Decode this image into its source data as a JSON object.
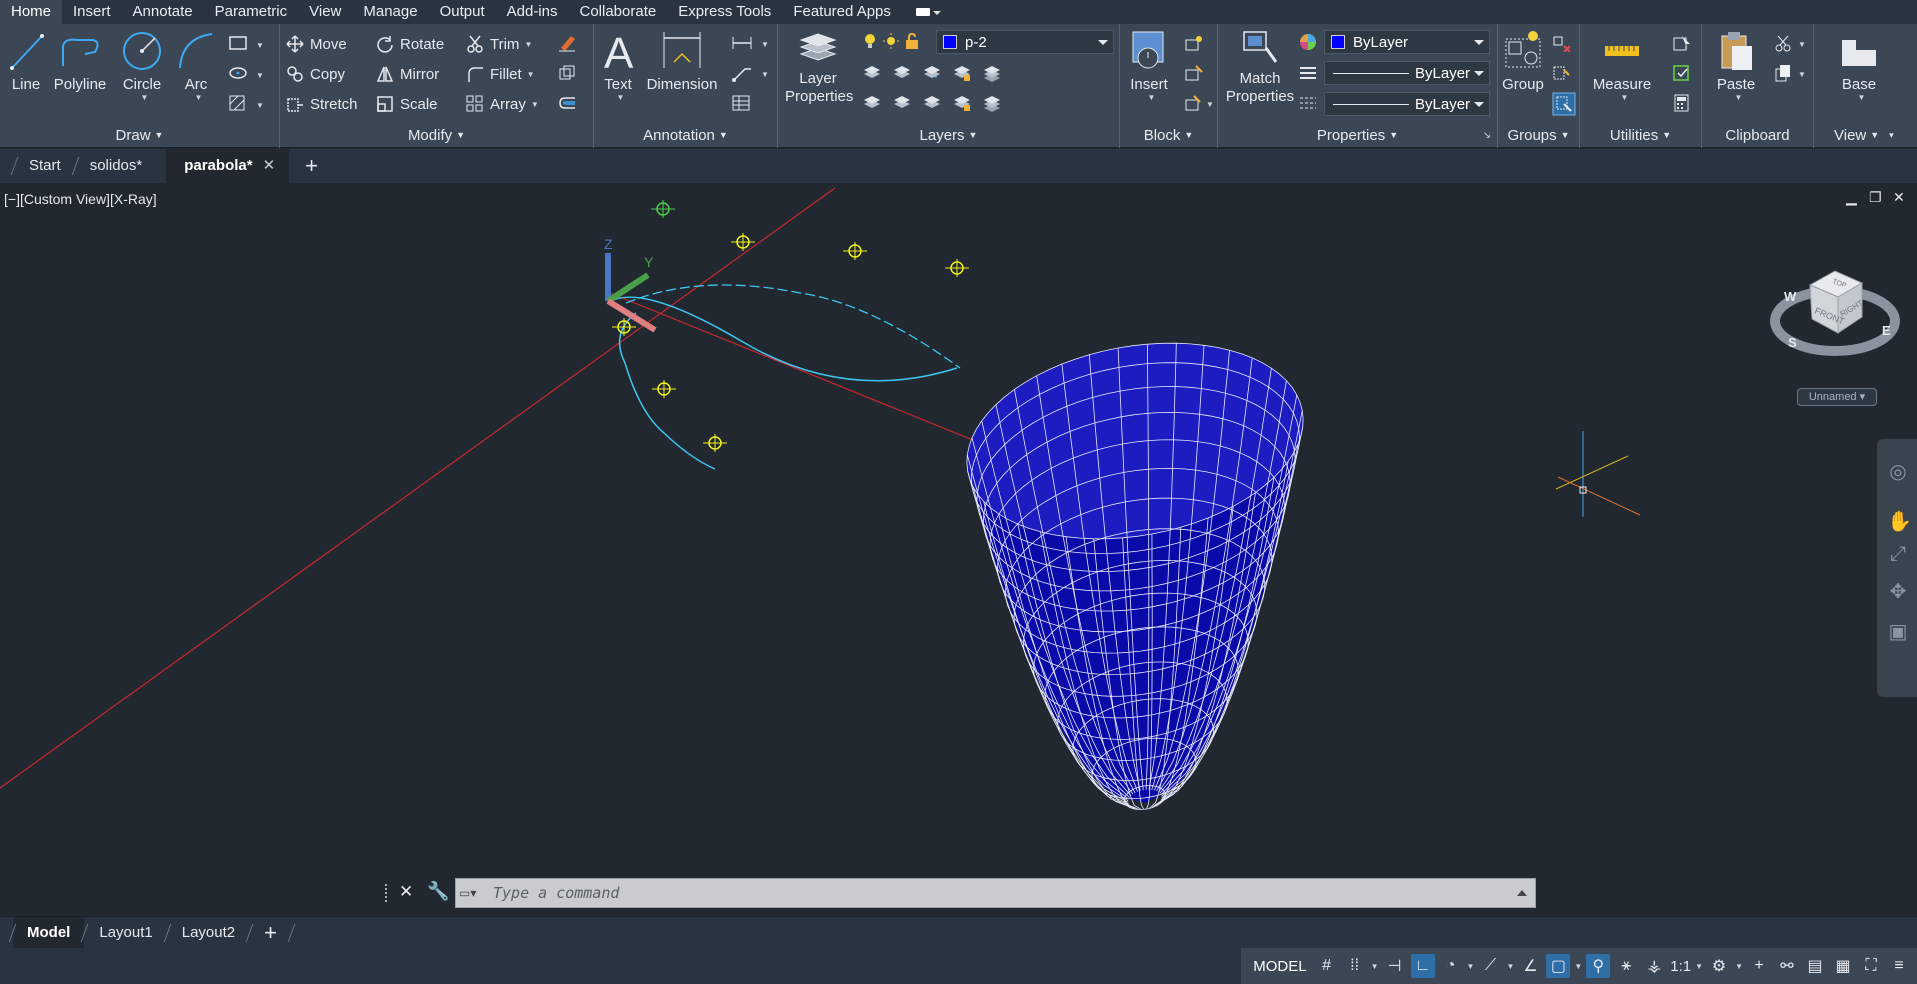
{
  "ribbon_tabs": [
    "Home",
    "Insert",
    "Annotate",
    "Parametric",
    "View",
    "Manage",
    "Output",
    "Add-ins",
    "Collaborate",
    "Express Tools",
    "Featured Apps"
  ],
  "active_ribbon_tab": "Home",
  "panels": {
    "draw": {
      "title": "Draw",
      "tools": {
        "line": "Line",
        "polyline": "Polyline",
        "circle": "Circle",
        "arc": "Arc"
      }
    },
    "modify": {
      "title": "Modify",
      "tools": {
        "move": "Move",
        "rotate": "Rotate",
        "trim": "Trim",
        "copy": "Copy",
        "mirror": "Mirror",
        "fillet": "Fillet",
        "stretch": "Stretch",
        "scale": "Scale",
        "array": "Array"
      }
    },
    "annotation": {
      "title": "Annotation",
      "tools": {
        "text": "Text",
        "dimension": "Dimension"
      }
    },
    "layers": {
      "title": "Layers",
      "layer_properties": "Layer Properties",
      "current_layer": "p-2"
    },
    "block": {
      "title": "Block",
      "insert": "Insert"
    },
    "properties": {
      "title": "Properties",
      "match_properties": "Match Properties",
      "color": "ByLayer",
      "linetype": "ByLayer",
      "lineweight": "ByLayer"
    },
    "groups": {
      "title": "Groups",
      "group": "Group"
    },
    "utilities": {
      "title": "Utilities",
      "measure": "Measure"
    },
    "clipboard": {
      "title": "Clipboard",
      "paste": "Paste"
    },
    "view": {
      "title": "View",
      "base": "Base"
    }
  },
  "file_tabs": [
    {
      "label": "Start",
      "active": false
    },
    {
      "label": "solidos*",
      "active": false
    },
    {
      "label": "parabola*",
      "active": true
    }
  ],
  "viewport": {
    "label": "[−][Custom View][X-Ray]",
    "ucs_labels": {
      "z": "Z",
      "y": "Y"
    },
    "viewcube": {
      "top": "TOP",
      "front": "FRONT",
      "right": "RIGHT",
      "w": "W",
      "s": "S",
      "e": "E"
    },
    "named_view": "Unnamed"
  },
  "command_line": {
    "placeholder": "Type a command"
  },
  "layout_tabs": [
    {
      "label": "Model",
      "active": true
    },
    {
      "label": "Layout1",
      "active": false
    },
    {
      "label": "Layout2",
      "active": false
    }
  ],
  "status_bar": {
    "model": "MODEL",
    "annotation_scale": "1:1"
  },
  "colors": {
    "accent_blue": "#0000ff",
    "ribbon_bg": "#3b4754",
    "canvas_bg": "#212830",
    "grip_yellow": "#f2f21e",
    "axis_red": "#c8282d",
    "spline_cyan": "#3fc4f0"
  }
}
